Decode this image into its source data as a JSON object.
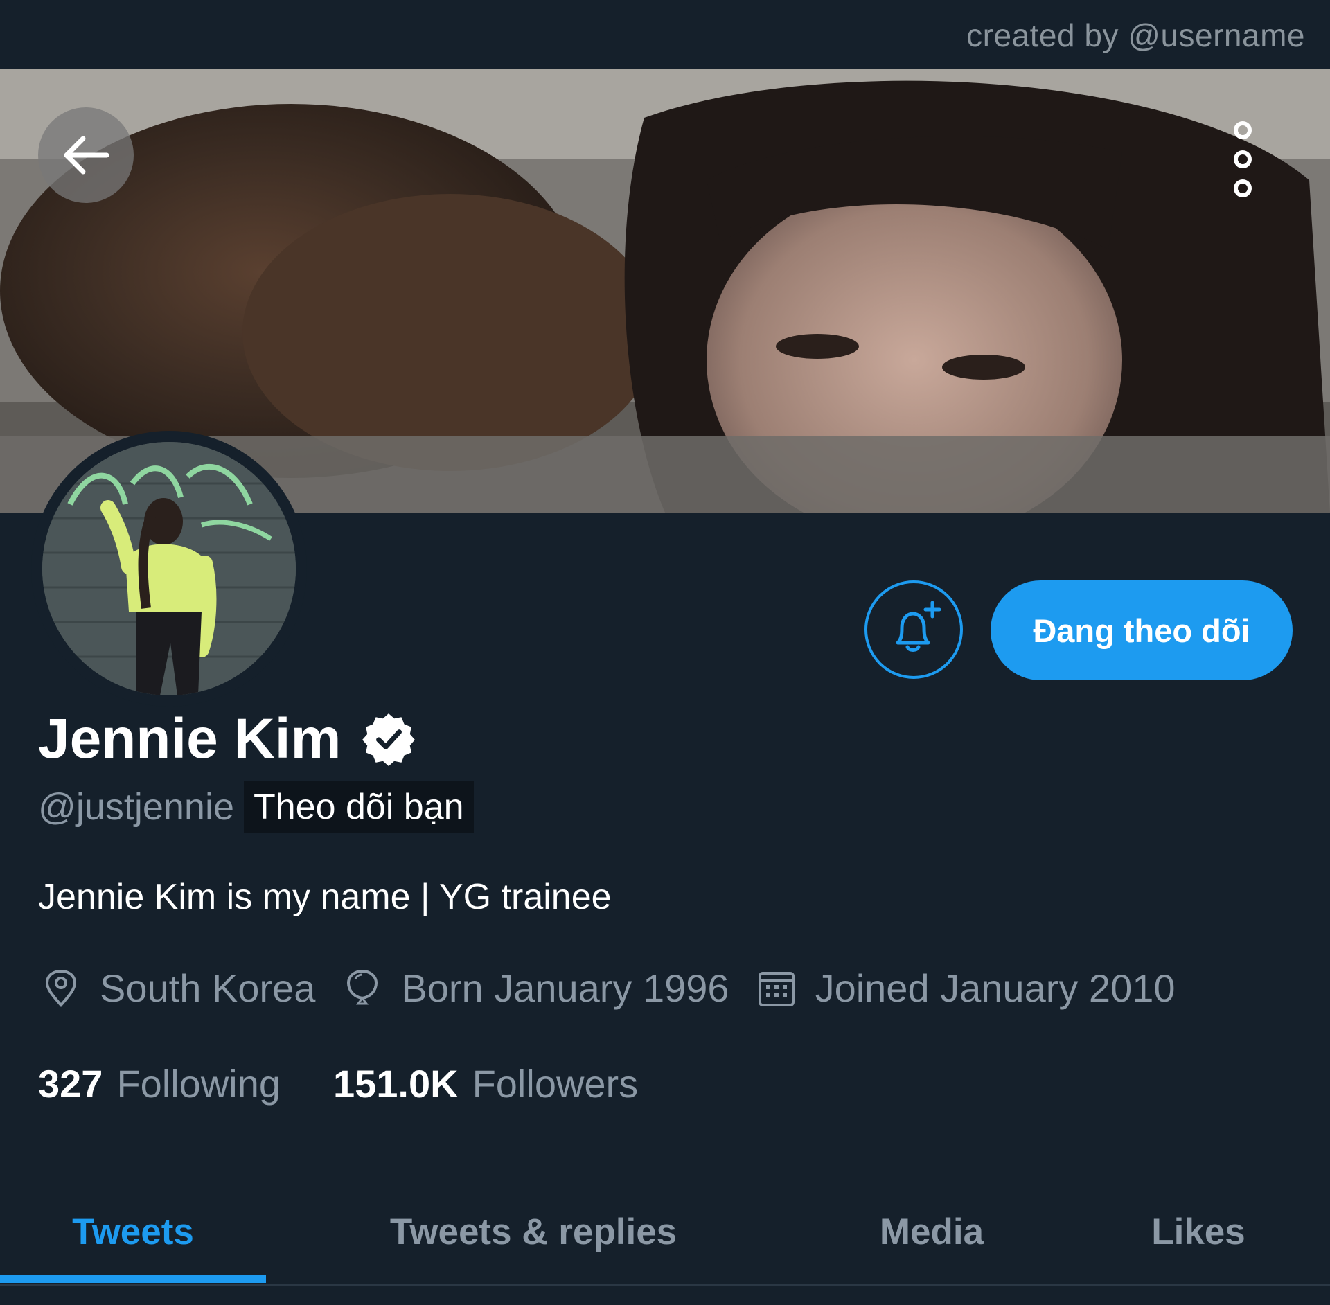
{
  "credit": "created by @username",
  "profile": {
    "name": "Jennie Kim",
    "handle": "@justjennie",
    "follows_you": "Theo dõi bạn",
    "bio": "Jennie Kim is my name | YG trainee",
    "location": "South Korea",
    "born": "Born January 1996",
    "joined": "Joined January 2010",
    "following_count": "327",
    "following_label": "Following",
    "followers_count": "151.0K",
    "followers_label": "Followers"
  },
  "actions": {
    "follow_label": "Đang theo dõi",
    "bell_icon": "bell-plus-icon",
    "back_icon": "arrow-left-icon",
    "more_icon": "more-vertical-icon"
  },
  "tabs": [
    {
      "label": "Tweets",
      "active": true
    },
    {
      "label": "Tweets & replies",
      "active": false
    },
    {
      "label": "Media",
      "active": false
    },
    {
      "label": "Likes",
      "active": false
    }
  ],
  "colors": {
    "background": "#15202b",
    "accent": "#1d9bf0",
    "secondary_text": "#8b98a5"
  }
}
